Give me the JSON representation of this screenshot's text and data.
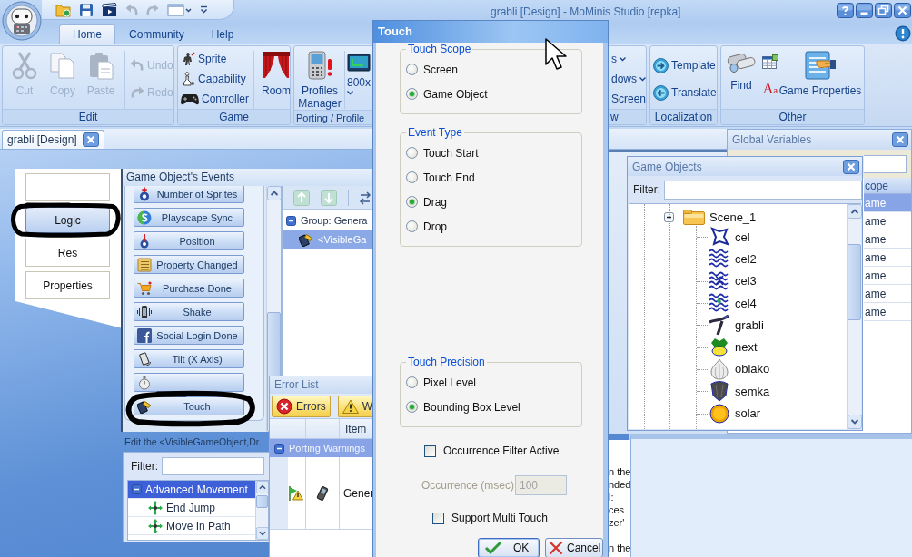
{
  "title_bar": {
    "title": "grabli [Design] - MoMinis Studio [repka]",
    "quick_access": [
      {
        "disabled": false
      },
      {
        "disabled": false
      },
      {
        "disabled": false
      },
      {
        "disabled": true
      },
      {
        "disabled": true
      },
      {
        "disabled": false
      },
      {
        "disabled": false
      }
    ]
  },
  "ribbon": {
    "tabs": [
      {
        "label": "Home",
        "selected": true
      },
      {
        "label": "Community",
        "selected": false
      },
      {
        "label": "Help",
        "selected": false
      }
    ],
    "groups": [
      {
        "label": "Edit",
        "buttons": [
          {
            "label": "Cut",
            "disabled": true
          },
          {
            "label": "Copy",
            "disabled": true
          },
          {
            "label": "Paste",
            "disabled": true
          },
          {
            "label": "Undo",
            "disabled": true
          },
          {
            "label": "Redo",
            "disabled": true
          }
        ]
      },
      {
        "label": "Game",
        "buttons": [
          {
            "label": "Sprite"
          },
          {
            "label": "Capability"
          },
          {
            "label": "Controller"
          },
          {
            "label": "Room"
          }
        ]
      },
      {
        "label": "Porting / Profile",
        "buttons": [
          {
            "label": "Profiles Manager"
          },
          {
            "label": "800x"
          }
        ]
      },
      {
        "label": "w",
        "buttons": [
          {
            "label": "s"
          },
          {
            "label": "dows"
          },
          {
            "label": "Screen"
          }
        ]
      },
      {
        "label": "Localization",
        "buttons": [
          {
            "label": "Template"
          },
          {
            "label": "Translate"
          }
        ]
      },
      {
        "label": "Other",
        "buttons": [
          {
            "label": "Find"
          },
          {
            "label": "Aa"
          },
          {
            "label": "Game Properties"
          }
        ]
      }
    ]
  },
  "document_tab": {
    "label": "grabli [Design]"
  },
  "designer_tabs": [
    {
      "selected": false
    },
    {
      "label": "Logic",
      "selected": true
    },
    {
      "label": "Res",
      "selected": false
    },
    {
      "label": "Properties",
      "selected": false
    }
  ],
  "events_panel": {
    "title": "Game Object's Events",
    "events": [
      {
        "kind": "labeled",
        "label": "Number of Sprites"
      },
      {
        "kind": "labeled",
        "label": "Playscape Sync"
      },
      {
        "kind": "labeled",
        "label": "Position"
      },
      {
        "kind": "labeled",
        "label": "Property Changed"
      },
      {
        "kind": "labeled",
        "label": "Purchase Done"
      },
      {
        "kind": "labeled",
        "label": "Shake"
      },
      {
        "kind": "labeled",
        "label": "Social Login Done"
      },
      {
        "kind": "labeled",
        "label": "Tilt (X Axis)"
      },
      {
        "kind": "unlabeled"
      },
      {
        "kind": "labeled",
        "label": "Touch"
      }
    ],
    "tree": [
      {
        "label": "Group: Genera",
        "expanded": true,
        "selected": false,
        "children": [
          {
            "label": "<VisibleGa",
            "selected": true
          }
        ]
      }
    ]
  },
  "action_editor": {
    "title": "Edit the <VisibleGameObject,Dr.",
    "filter": {
      "label": "Filter:"
    },
    "tree": [
      {
        "label": "Advanced Movement",
        "expanded": true,
        "selected": true,
        "children": [
          {
            "label": "End Jump",
            "selected": false
          },
          {
            "label": "Move In Path",
            "selected": false
          }
        ]
      }
    ]
  },
  "error_list": {
    "title": "Error List",
    "buttons": [
      {
        "label": "Errors"
      },
      {
        "label": "W"
      }
    ],
    "grid": {
      "column_3": "Item",
      "groups": [
        {
          "label": "Porting Warnings",
          "expanded": true,
          "rows": [
            {
              "column_3": "Gener"
            }
          ]
        }
      ]
    }
  },
  "details_panel": {
    "lines": [
      "n the",
      "nded",
      "l:",
      "ces",
      "zer'",
      "n the"
    ]
  },
  "global_variables": {
    "title": "Global Variables",
    "table": {
      "column": "cope",
      "rows": [
        {
          "cell": "ame",
          "selected": true
        },
        {
          "cell": "ame",
          "selected": false
        },
        {
          "cell": "ame",
          "selected": false
        },
        {
          "cell": "ame",
          "selected": false
        },
        {
          "cell": "ame",
          "selected": false
        },
        {
          "cell": "ame",
          "selected": false
        },
        {
          "cell": "ame",
          "selected": false
        }
      ]
    }
  },
  "game_objects": {
    "title": "Game Objects",
    "filter": {
      "label": "Filter:"
    },
    "tree": [
      {
        "label": "Scene_1",
        "expanded": true,
        "children": [
          {
            "label": "cel"
          },
          {
            "label": "cel2"
          },
          {
            "label": "cel3"
          },
          {
            "label": "cel4"
          },
          {
            "label": "grabli"
          },
          {
            "label": "next"
          },
          {
            "label": "oblako"
          },
          {
            "label": "semka"
          },
          {
            "label": "solar"
          }
        ]
      }
    ]
  },
  "touch_dialog": {
    "title": "Touch",
    "groups": [
      {
        "title": "Touch Scope",
        "options": [
          {
            "label": "Screen",
            "selected": false
          },
          {
            "label": "Game Object",
            "selected": true
          }
        ]
      },
      {
        "title": "Event Type",
        "options": [
          {
            "label": "Touch Start",
            "selected": false
          },
          {
            "label": "Touch End",
            "selected": false
          },
          {
            "label": "Drag",
            "selected": true
          },
          {
            "label": "Drop",
            "selected": false
          }
        ]
      },
      {
        "title": "Touch Precision",
        "options": [
          {
            "label": "Pixel Level",
            "selected": false
          },
          {
            "label": "Bounding Box Level",
            "selected": true
          }
        ]
      }
    ],
    "occurrence_filter": {
      "label": "Occurrence Filter Active",
      "checked": false
    },
    "occurrence": {
      "label": "Occurrence (msec)",
      "value": "100",
      "disabled": true
    },
    "multi_touch": {
      "label": "Support Multi Touch",
      "checked": false
    },
    "buttons": [
      {
        "label": "OK"
      },
      {
        "label": "Cancel"
      }
    ]
  }
}
